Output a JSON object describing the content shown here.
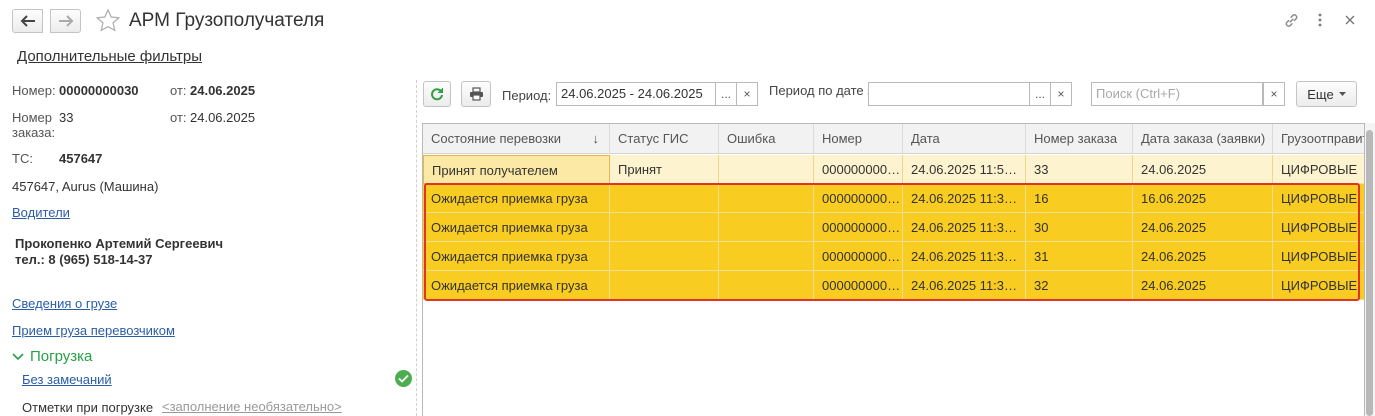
{
  "header": {
    "title": "АРМ Грузополучателя",
    "icons": {
      "back": "arrow-left-icon",
      "forward": "arrow-right-icon",
      "favorite": "star-icon",
      "link": "link-icon",
      "menu": "more-vertical-icon",
      "close": "close-icon"
    }
  },
  "left_panel": {
    "additional_filters": "Дополнительные фильтры",
    "number_label": "Номер:",
    "number_value": "00000000030",
    "number_from_label": "от:",
    "number_from_value": "24.06.2025",
    "order_number_label": "Номер заказа:",
    "order_number_value": "33",
    "order_from_label": "от:",
    "order_from_value": "24.06.2025",
    "vehicle_label": "ТС:",
    "vehicle_value": "457647",
    "vehicle_desc": "457647, Aurus (Машина)",
    "drivers_link": "Водители",
    "driver_name": "Прокопенко Артемий Сергеевич",
    "driver_phone": "тел.: 8 (965) 518-14-37",
    "cargo_info_link": "Сведения о грузе",
    "carrier_accept_link": "Прием груза перевозчиком",
    "loading_group": "Погрузка",
    "no_remarks_link": "Без замечаний",
    "loading_marks_label": "Отметки при погрузке",
    "loading_marks_hint": "<заполнение необязательно>"
  },
  "toolbar": {
    "period_label": "Период:",
    "period_value": "24.06.2025 - 24.06.2025",
    "order_period_label": "Период по дате заказа:",
    "order_period_value": "",
    "search_placeholder": "Поиск (Ctrl+F)",
    "more_label": "Еще",
    "ellipsis": "...",
    "clear": "×"
  },
  "colors": {
    "accent_green": "#25a246",
    "selected_row": "#f9cc21",
    "current_row": "#fdf3cf",
    "highlight_border": "#e0332a",
    "link_blue": "#2a5da8"
  },
  "grid": {
    "columns": [
      "Состояние перевозки",
      "Статус ГИС",
      "Ошибка",
      "Номер",
      "Дата",
      "Номер заказа",
      "Дата заказа (заявки)",
      "Грузоотправитель"
    ],
    "sort_indicator": "↓",
    "rows": [
      [
        "Принят получателем",
        "Принят",
        "",
        "000000000…",
        "24.06.2025 11:5…",
        "33",
        "24.06.2025",
        "ЦИФРОВЫЕ"
      ],
      [
        "Ожидается приемка груза",
        "",
        "",
        "000000000…",
        "24.06.2025 11:3…",
        "16",
        "16.06.2025",
        "ЦИФРОВЫЕ"
      ],
      [
        "Ожидается приемка груза",
        "",
        "",
        "000000000…",
        "24.06.2025 11:3…",
        "30",
        "24.06.2025",
        "ЦИФРОВЫЕ"
      ],
      [
        "Ожидается приемка груза",
        "",
        "",
        "000000000…",
        "24.06.2025 11:3…",
        "31",
        "24.06.2025",
        "ЦИФРОВЫЕ"
      ],
      [
        "Ожидается приемка груза",
        "",
        "",
        "000000000…",
        "24.06.2025 11:3…",
        "32",
        "24.06.2025",
        "ЦИФРОВЫЕ"
      ]
    ]
  }
}
